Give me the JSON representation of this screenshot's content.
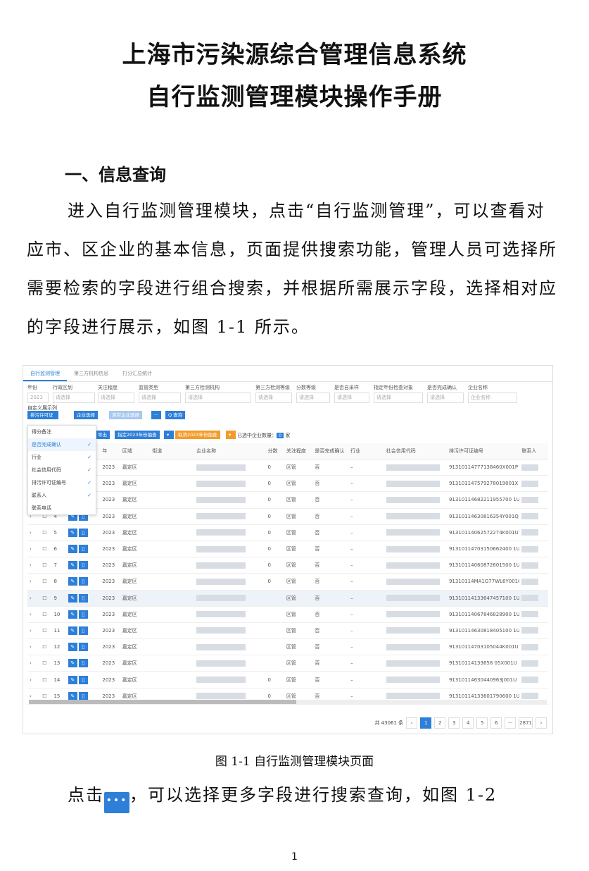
{
  "doc": {
    "title1": "上海市污染源综合管理信息系统",
    "title2": "自行监测管理模块操作手册",
    "section": "一、信息查询",
    "paragraph1": "进入自行监测管理模块，点击“自行监测管理”，可以查看对应市、区企业的基本信息，页面提供搜索功能，管理人员可选择所需要检索的字段进行组合搜索，并根据所需展示字段，选择相对应的字段进行展示，如图 1-1 所示。",
    "caption": "图  1-1    自行监测管理模块页面",
    "paragraph2_before": "点击",
    "paragraph2_after": "，可以选择更多字段进行搜索查询，如图 1-2",
    "page_number": "1"
  },
  "shot": {
    "tabs": [
      "自行监测管理",
      "第三方机构信息",
      "打分汇总统计"
    ],
    "filters": [
      {
        "label": "年份",
        "value": "2023"
      },
      {
        "label": "行政区划",
        "value": "请选择"
      },
      {
        "label": "关注程度",
        "value": "请选择"
      },
      {
        "label": "监管类型",
        "value": "请选择"
      },
      {
        "label": "第三方检测机构",
        "value": "请选择"
      },
      {
        "label": "第三方检测等级",
        "value": "请选择"
      },
      {
        "label": "分数等级",
        "value": "请选择"
      },
      {
        "label": "是否自采样",
        "value": "请选择"
      },
      {
        "label": "指定年份检查对象",
        "value": "请选择"
      },
      {
        "label": "是否完成确认",
        "value": "请选择"
      },
      {
        "label": "企业名称",
        "value": "企业名称"
      }
    ],
    "custom_label": "自定义展示列",
    "custom_value": "排污许可证编号",
    "btn_company_select": "企业选择",
    "btn_clear_select": "清空企业选择",
    "btn_more": "···",
    "btn_query": "Q 查询",
    "btn_export": "导出",
    "btn_assign": "指定2023年份抽查",
    "btn_cancel": "取消2023年份抽查",
    "selected_text": "已选中企业数量：",
    "selected_count": "0",
    "selected_unit": "家",
    "menu": [
      {
        "label": "得分备注",
        "checked": false
      },
      {
        "label": "是否完成确认",
        "checked": true
      },
      {
        "label": "行业",
        "checked": true
      },
      {
        "label": "社会信用代码",
        "checked": true
      },
      {
        "label": "排污许可证编号",
        "checked": true
      },
      {
        "label": "联系人",
        "checked": true
      },
      {
        "label": "联系电话",
        "checked": false
      }
    ],
    "columns": [
      "",
      "",
      "",
      "操作",
      "年",
      "区域",
      "街道",
      "企业名称",
      "分数",
      "关注程度",
      "是否完成确认",
      "行业",
      "社会信用代码",
      "排污许可证编号",
      "联系人"
    ],
    "rows": [
      {
        "n": "1",
        "year": "2023",
        "area": "嘉定区",
        "score": "0",
        "level": "区管",
        "confirm": "否",
        "industry": "–",
        "permit": "91310114777138460X001P"
      },
      {
        "n": "2",
        "year": "2023",
        "area": "嘉定区",
        "score": "0",
        "level": "区管",
        "confirm": "否",
        "industry": "–",
        "permit": "913101147579278019001X"
      },
      {
        "n": "3",
        "year": "2023",
        "area": "嘉定区",
        "score": "0",
        "level": "区管",
        "confirm": "否",
        "industry": "–",
        "permit": "91310114682211955700 1U"
      },
      {
        "n": "4",
        "year": "2023",
        "area": "嘉定区",
        "score": "0",
        "level": "区管",
        "confirm": "否",
        "industry": "–",
        "permit": "91310114630816354Y001Q"
      },
      {
        "n": "5",
        "year": "2023",
        "area": "嘉定区",
        "score": "0",
        "level": "区管",
        "confirm": "否",
        "industry": "–",
        "permit": "91310114062572274K001U"
      },
      {
        "n": "6",
        "year": "2023",
        "area": "嘉定区",
        "score": "0",
        "level": "区管",
        "confirm": "否",
        "industry": "–",
        "permit": "91310114703150662400 1U"
      },
      {
        "n": "7",
        "year": "2023",
        "area": "嘉定区",
        "score": "0",
        "level": "区管",
        "confirm": "否",
        "industry": "–",
        "permit": "91310114060872601500 1U"
      },
      {
        "n": "8",
        "year": "2023",
        "area": "嘉定区",
        "score": "0",
        "level": "区管",
        "confirm": "否",
        "industry": "–",
        "permit": "91310114MA1G77WL6Y001Q"
      },
      {
        "n": "9",
        "year": "2023",
        "area": "嘉定区",
        "score": "",
        "level": "区管",
        "confirm": "否",
        "industry": "–",
        "permit": "91310114133647457100 1U"
      },
      {
        "n": "10",
        "year": "2023",
        "area": "嘉定区",
        "score": "",
        "level": "区管",
        "confirm": "否",
        "industry": "–",
        "permit": "91310114067846828900 1U"
      },
      {
        "n": "11",
        "year": "2023",
        "area": "嘉定区",
        "score": "",
        "level": "区管",
        "confirm": "否",
        "industry": "–",
        "permit": "91310114630818405100 1U"
      },
      {
        "n": "12",
        "year": "2023",
        "area": "嘉定区",
        "score": "",
        "level": "区管",
        "confirm": "否",
        "industry": "–",
        "permit": "91310114703105044K001U"
      },
      {
        "n": "13",
        "year": "2023",
        "area": "嘉定区",
        "score": "",
        "level": "区管",
        "confirm": "否",
        "industry": "–",
        "permit": "91310114133658 05X001U"
      },
      {
        "n": "14",
        "year": "2023",
        "area": "嘉定区",
        "score": "0",
        "level": "区管",
        "confirm": "否",
        "industry": "–",
        "permit": "91310114630440963J001U"
      },
      {
        "n": "15",
        "year": "2023",
        "area": "嘉定区",
        "score": "0",
        "level": "区管",
        "confirm": "否",
        "industry": "–",
        "permit": "91310114133601790600 1U"
      }
    ],
    "total": "共 43061 条",
    "pages": [
      "1",
      "2",
      "3",
      "4",
      "5",
      "6",
      "···",
      "2871"
    ]
  },
  "colors": {
    "primary": "#2d7fd8",
    "orange": "#f39c2b"
  }
}
